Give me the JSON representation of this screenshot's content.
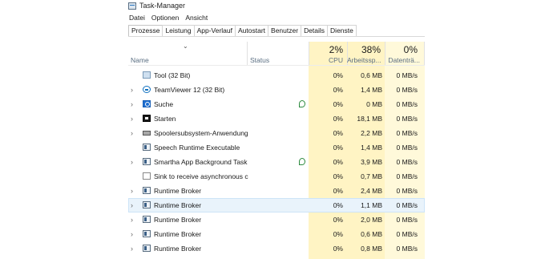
{
  "window": {
    "title": "Task-Manager"
  },
  "menu": [
    "Datei",
    "Optionen",
    "Ansicht"
  ],
  "tabs": [
    "Prozesse",
    "Leistung",
    "App-Verlauf",
    "Autostart",
    "Benutzer",
    "Details",
    "Dienste"
  ],
  "active_tab": "Prozesse",
  "columns": {
    "name": "Name",
    "status": "Status",
    "cpu_pct": "2%",
    "cpu": "CPU",
    "mem_pct": "38%",
    "mem": "Arbeitssp...",
    "disk_pct": "0%",
    "disk": "Datenträ..."
  },
  "colors": {
    "highlight": "#fff4c4",
    "selected": "#e9f3fb",
    "header_text": "#5a6e82"
  },
  "processes": [
    {
      "expand": "",
      "icon": "tool-icon",
      "name": "Tool (32 Bit)",
      "leaf": false,
      "cpu": "0%",
      "mem": "0,6 MB",
      "disk": "0 MB/s"
    },
    {
      "expand": "›",
      "icon": "teamviewer-icon",
      "name": "TeamViewer 12 (32 Bit)",
      "leaf": false,
      "cpu": "0%",
      "mem": "1,4 MB",
      "disk": "0 MB/s"
    },
    {
      "expand": "›",
      "icon": "search-icon",
      "name": "Suche",
      "leaf": true,
      "cpu": "0%",
      "mem": "0 MB",
      "disk": "0 MB/s"
    },
    {
      "expand": "›",
      "icon": "start-icon",
      "name": "Starten",
      "leaf": false,
      "cpu": "0%",
      "mem": "18,1 MB",
      "disk": "0 MB/s"
    },
    {
      "expand": "›",
      "icon": "printer-icon",
      "name": "Spoolersubsystem-Anwendung",
      "leaf": false,
      "cpu": "0%",
      "mem": "2,2 MB",
      "disk": "0 MB/s"
    },
    {
      "expand": "",
      "icon": "window-icon",
      "name": "Speech Runtime Executable",
      "leaf": false,
      "cpu": "0%",
      "mem": "1,4 MB",
      "disk": "0 MB/s"
    },
    {
      "expand": "›",
      "icon": "window-icon",
      "name": "Smartha App Background Task ...",
      "leaf": true,
      "cpu": "0%",
      "mem": "3,9 MB",
      "disk": "0 MB/s"
    },
    {
      "expand": "",
      "icon": "blank-icon",
      "name": "Sink to receive asynchronous cal...",
      "leaf": false,
      "cpu": "0%",
      "mem": "0,7 MB",
      "disk": "0 MB/s"
    },
    {
      "expand": "›",
      "icon": "window-icon",
      "name": "Runtime Broker",
      "leaf": false,
      "cpu": "0%",
      "mem": "2,4 MB",
      "disk": "0 MB/s"
    },
    {
      "expand": "›",
      "icon": "window-icon",
      "name": "Runtime Broker",
      "leaf": false,
      "cpu": "0%",
      "mem": "1,1 MB",
      "disk": "0 MB/s",
      "selected": true
    },
    {
      "expand": "›",
      "icon": "window-icon",
      "name": "Runtime Broker",
      "leaf": false,
      "cpu": "0%",
      "mem": "2,0 MB",
      "disk": "0 MB/s"
    },
    {
      "expand": "›",
      "icon": "window-icon",
      "name": "Runtime Broker",
      "leaf": false,
      "cpu": "0%",
      "mem": "0,6 MB",
      "disk": "0 MB/s"
    },
    {
      "expand": "›",
      "icon": "window-icon",
      "name": "Runtime Broker",
      "leaf": false,
      "cpu": "0%",
      "mem": "0,8 MB",
      "disk": "0 MB/s"
    }
  ]
}
